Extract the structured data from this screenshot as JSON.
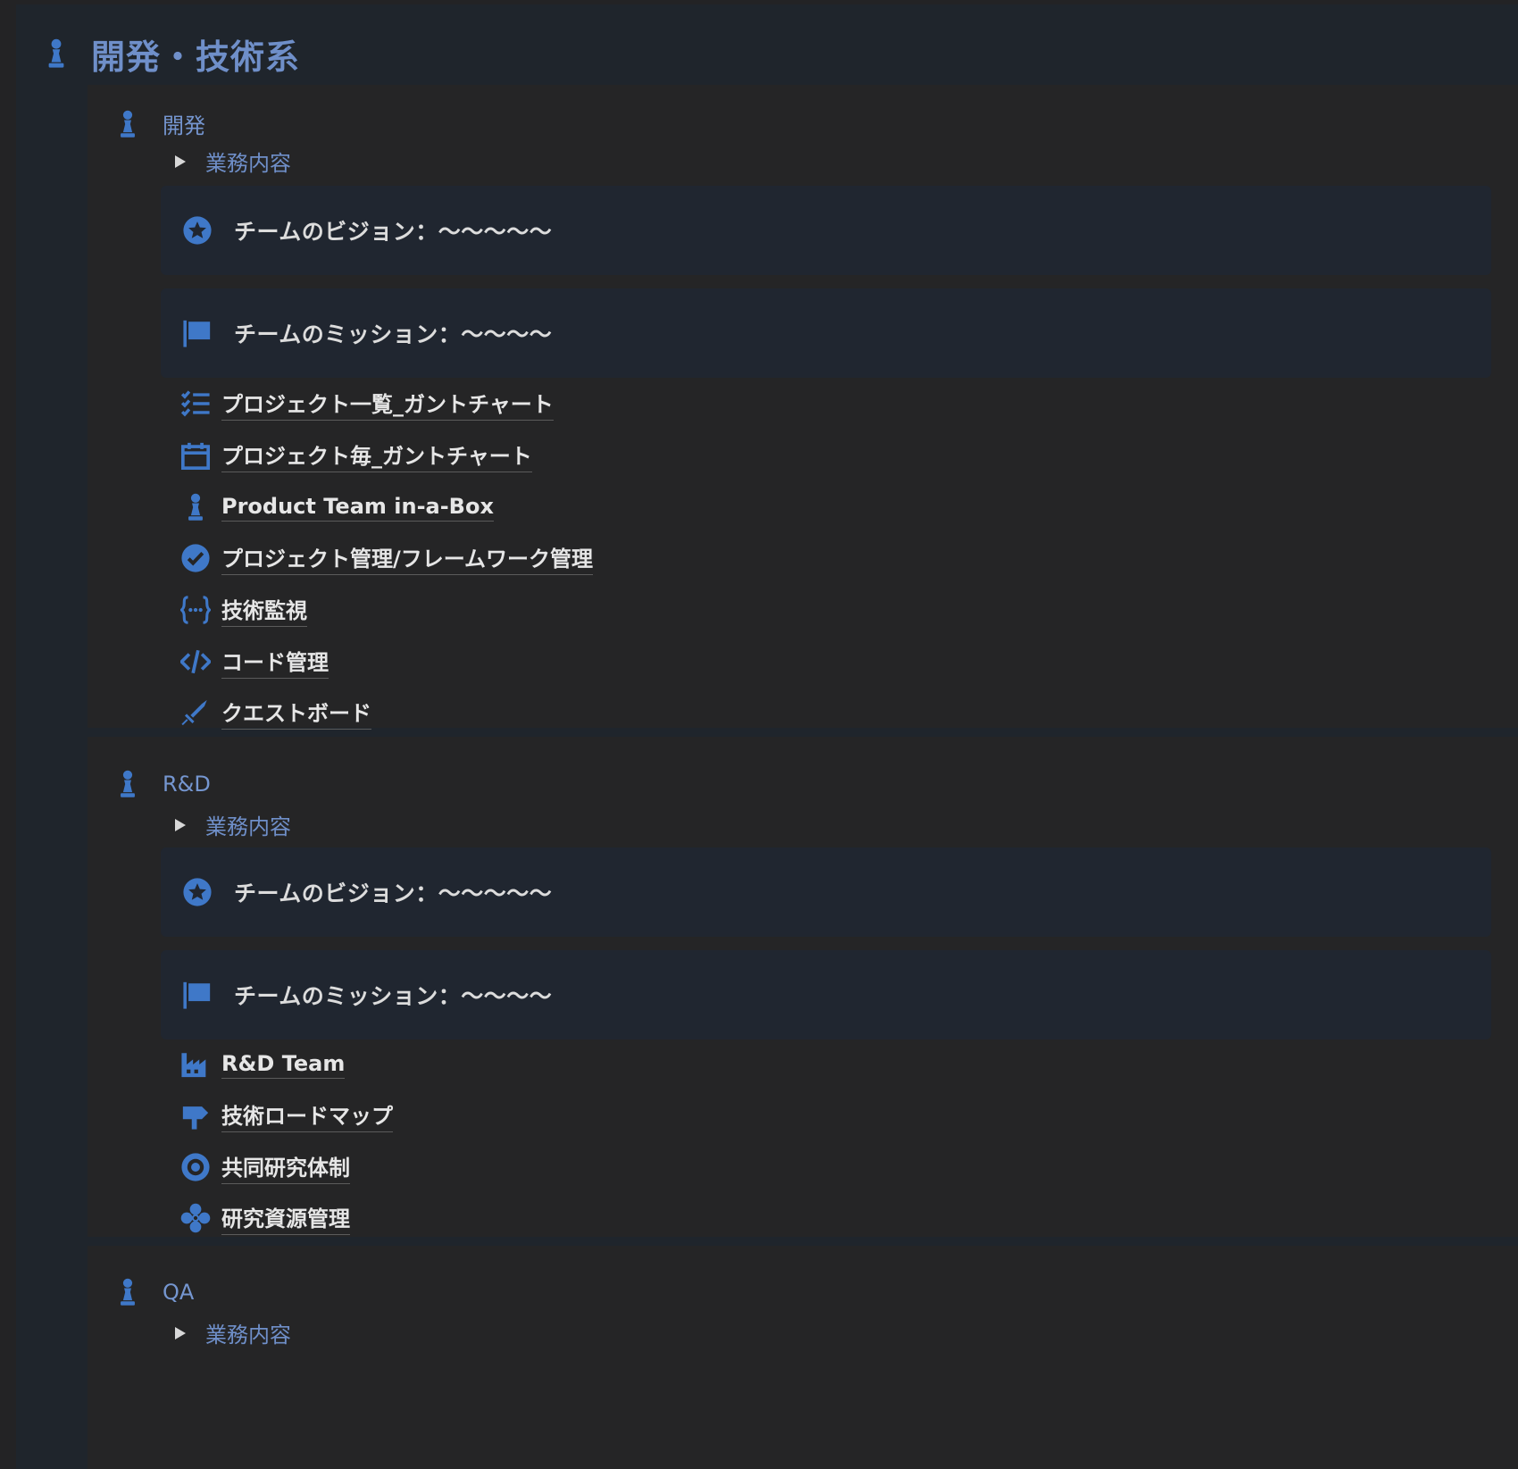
{
  "page": {
    "title": "開発・技術系"
  },
  "colors": {
    "accent": "#3f78c8",
    "title_text": "#6f8fc9",
    "callout_bg": "#202630",
    "section_bg": "#252526"
  },
  "sections": [
    {
      "name": "開発",
      "toggle": "業務内容",
      "vision": "チームのビジョン：〜〜〜〜〜",
      "mission": "チームのミッション：〜〜〜〜",
      "links": [
        {
          "label": "プロジェクト一覧_ガントチャート",
          "icon": "checklist-icon"
        },
        {
          "label": "プロジェクト毎_ガントチャート",
          "icon": "calendar-icon"
        },
        {
          "label": "Product Team in-a-Box",
          "icon": "chess-pawn-icon"
        },
        {
          "label": "プロジェクト管理/フレームワーク管理",
          "icon": "check-circle-icon"
        },
        {
          "label": "技術監視",
          "icon": "braces-icon"
        },
        {
          "label": "コード管理",
          "icon": "code-icon"
        },
        {
          "label": "クエストボード",
          "icon": "sword-icon"
        }
      ]
    },
    {
      "name": "R&D",
      "toggle": "業務内容",
      "vision": "チームのビジョン：〜〜〜〜〜",
      "mission": "チームのミッション：〜〜〜〜",
      "links": [
        {
          "label": "R&D Team",
          "icon": "factory-icon"
        },
        {
          "label": "技術ロードマップ",
          "icon": "signpost-icon"
        },
        {
          "label": "共同研究体制",
          "icon": "target-icon"
        },
        {
          "label": "研究資源管理",
          "icon": "asterisk-icon"
        }
      ]
    },
    {
      "name": "QA",
      "toggle": "業務内容"
    }
  ]
}
